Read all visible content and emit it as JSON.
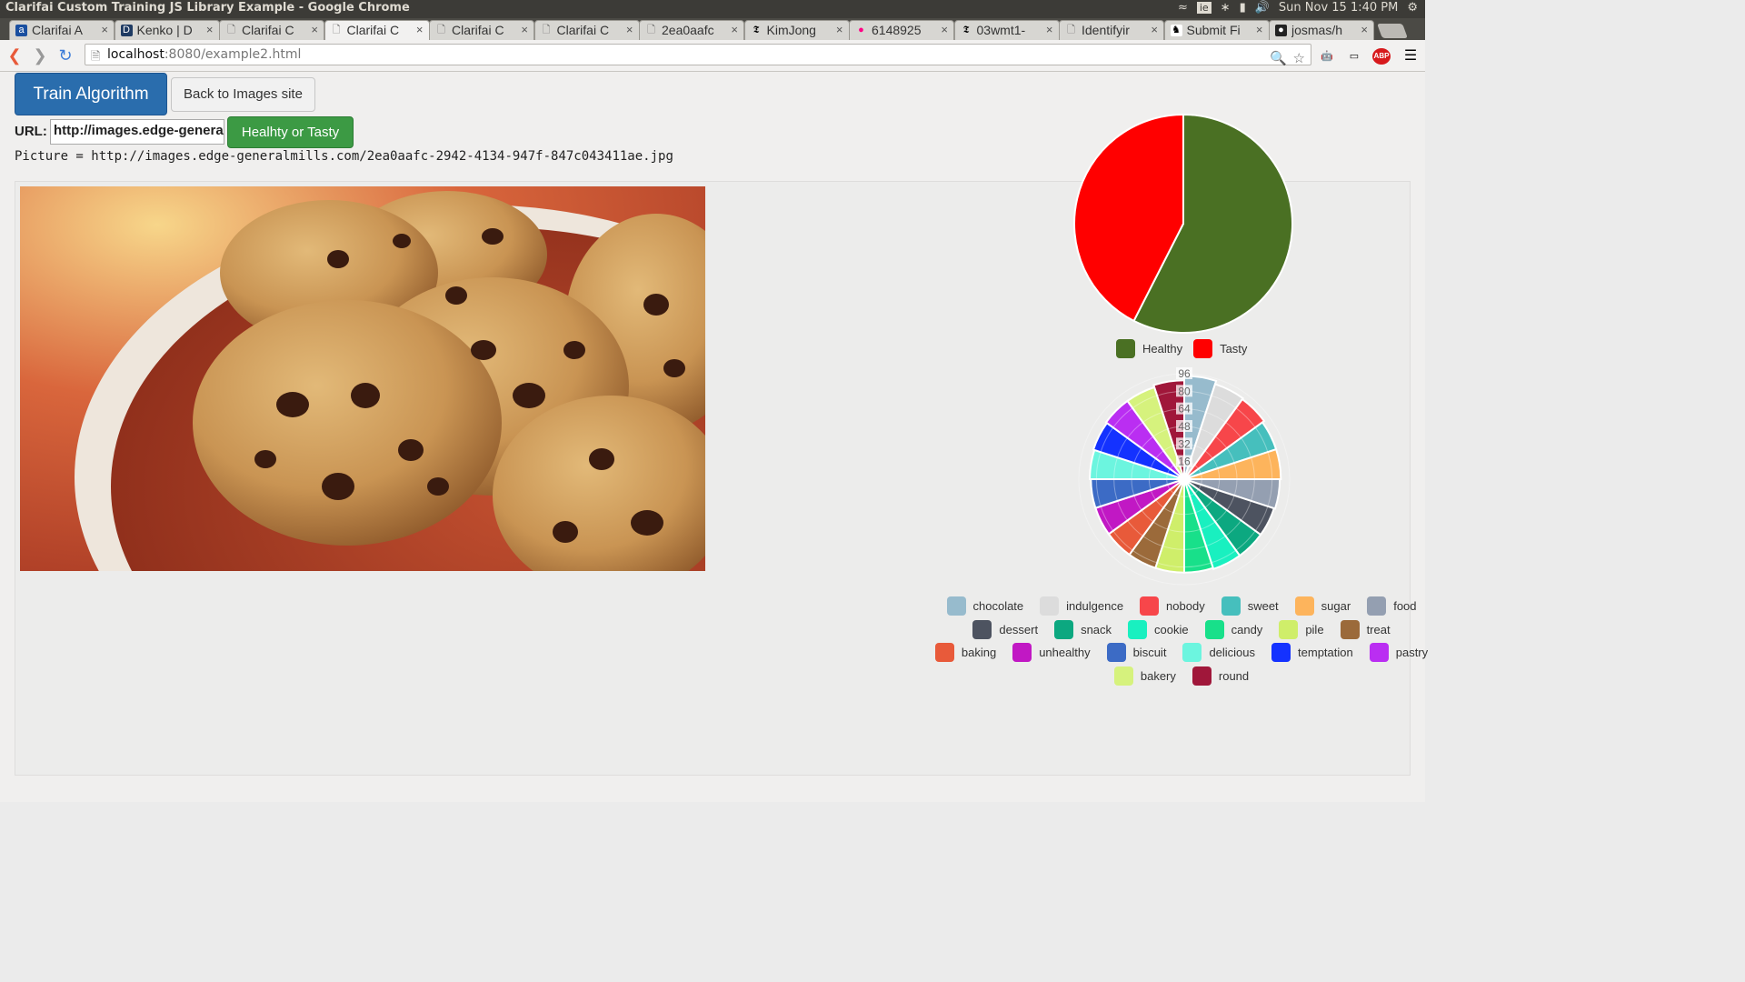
{
  "window": {
    "title": "Clarifai Custom Training JS Library Example - Google Chrome",
    "clock": "Sun Nov 15  1:40 PM"
  },
  "tabs": [
    {
      "label": "Clarifai A",
      "icon": "clarifai-favicon-icon"
    },
    {
      "label": "Kenko | D",
      "icon": "d-favicon-icon"
    },
    {
      "label": "Clarifai C",
      "icon": "page-icon"
    },
    {
      "label": "Clarifai C",
      "icon": "page-icon",
      "active": true
    },
    {
      "label": "Clarifai C",
      "icon": "page-icon"
    },
    {
      "label": "Clarifai C",
      "icon": "page-icon"
    },
    {
      "label": "2ea0aafc",
      "icon": "page-icon"
    },
    {
      "label": "KimJong",
      "icon": "nyt-favicon-icon"
    },
    {
      "label": "6148925",
      "icon": "flickr-favicon-icon"
    },
    {
      "label": "03wmt1-",
      "icon": "nyt-favicon-icon"
    },
    {
      "label": "Identifyir",
      "icon": "page-icon"
    },
    {
      "label": "Submit Fi",
      "icon": "submit-favicon-icon"
    },
    {
      "label": "josmas/h",
      "icon": "github-favicon-icon"
    }
  ],
  "address_bar": {
    "host": "localhost",
    "path": ":8080/example2.html"
  },
  "toolbar": {
    "train_label": "Train Algorithm",
    "back_label": "Back to Images site",
    "url_label": "URL:",
    "url_value": "http://images.edge-generalmills.com/2ea0aafc-2942-4134-947f-847c043411ae.jpg",
    "classify_label": "Healhty or Tasty"
  },
  "picture_line": "Picture = http://images.edge-generalmills.com/2ea0aafc-2942-4134-947f-847c043411ae.jpg",
  "extensions": {
    "abp": "ABP"
  },
  "chart_data": [
    {
      "type": "pie",
      "slices": [
        {
          "name": "Healthy",
          "value": 57.5,
          "color": "#4a7023"
        },
        {
          "name": "Tasty",
          "value": 42.5,
          "color": "#ff0000"
        }
      ]
    },
    {
      "type": "polarArea",
      "ticks": [
        "96",
        "80",
        "64",
        "48",
        "32",
        "16"
      ],
      "rmax": 96,
      "segments": [
        {
          "name": "chocolate",
          "value": 94,
          "color": "#97bbcd"
        },
        {
          "name": "indulgence",
          "value": 91,
          "color": "#dcdcdc"
        },
        {
          "name": "nobody",
          "value": 90,
          "color": "#f7464a"
        },
        {
          "name": "sweet",
          "value": 88,
          "color": "#46bfbd"
        },
        {
          "name": "sugar",
          "value": 88,
          "color": "#fdb45c"
        },
        {
          "name": "food",
          "value": 87,
          "color": "#949fb1"
        },
        {
          "name": "dessert",
          "value": 86,
          "color": "#4d5360"
        },
        {
          "name": "snack",
          "value": 86,
          "color": "#0ca880"
        },
        {
          "name": "cookie",
          "value": 86,
          "color": "#19f0c0"
        },
        {
          "name": "candy",
          "value": 85,
          "color": "#18e08a"
        },
        {
          "name": "pile",
          "value": 85,
          "color": "#cfee6a"
        },
        {
          "name": "treat",
          "value": 85,
          "color": "#9b6a3a"
        },
        {
          "name": "baking",
          "value": 85,
          "color": "#e85a3a"
        },
        {
          "name": "unhealthy",
          "value": 85,
          "color": "#c118c4"
        },
        {
          "name": "biscuit",
          "value": 85,
          "color": "#3c6bc5"
        },
        {
          "name": "delicious",
          "value": 86,
          "color": "#6cf5df"
        },
        {
          "name": "temptation",
          "value": 87,
          "color": "#1432ff"
        },
        {
          "name": "pastry",
          "value": 88,
          "color": "#ba2ef2"
        },
        {
          "name": "bakery",
          "value": 88,
          "color": "#d6f27d"
        },
        {
          "name": "round",
          "value": 90,
          "color": "#a0173a"
        }
      ]
    }
  ]
}
